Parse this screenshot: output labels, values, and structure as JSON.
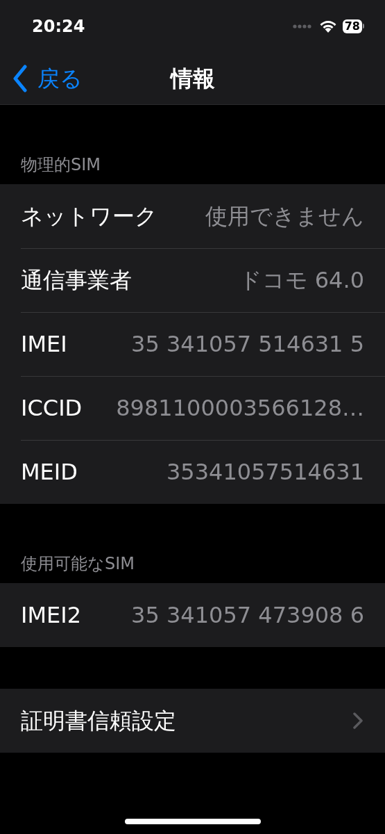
{
  "status_bar": {
    "time": "20:24",
    "battery": "78"
  },
  "nav": {
    "back": "戻る",
    "title": "情報"
  },
  "sections": [
    {
      "header": "物理的SIM",
      "rows": [
        {
          "kind": "value",
          "label": "ネットワーク",
          "value": "使用できません"
        },
        {
          "kind": "value",
          "label": "通信事業者",
          "value": "ドコモ 64.0"
        },
        {
          "kind": "value",
          "label": "IMEI",
          "value": "35 341057 514631 5"
        },
        {
          "kind": "value",
          "label": "ICCID",
          "value": "8981100003566128…"
        },
        {
          "kind": "value",
          "label": "MEID",
          "value": "35341057514631"
        }
      ]
    },
    {
      "header": "使用可能なSIM",
      "rows": [
        {
          "kind": "value",
          "label": "IMEI2",
          "value": "35 341057 473908 6"
        }
      ]
    },
    {
      "rows": [
        {
          "kind": "link",
          "label": "証明書信頼設定"
        }
      ]
    }
  ]
}
